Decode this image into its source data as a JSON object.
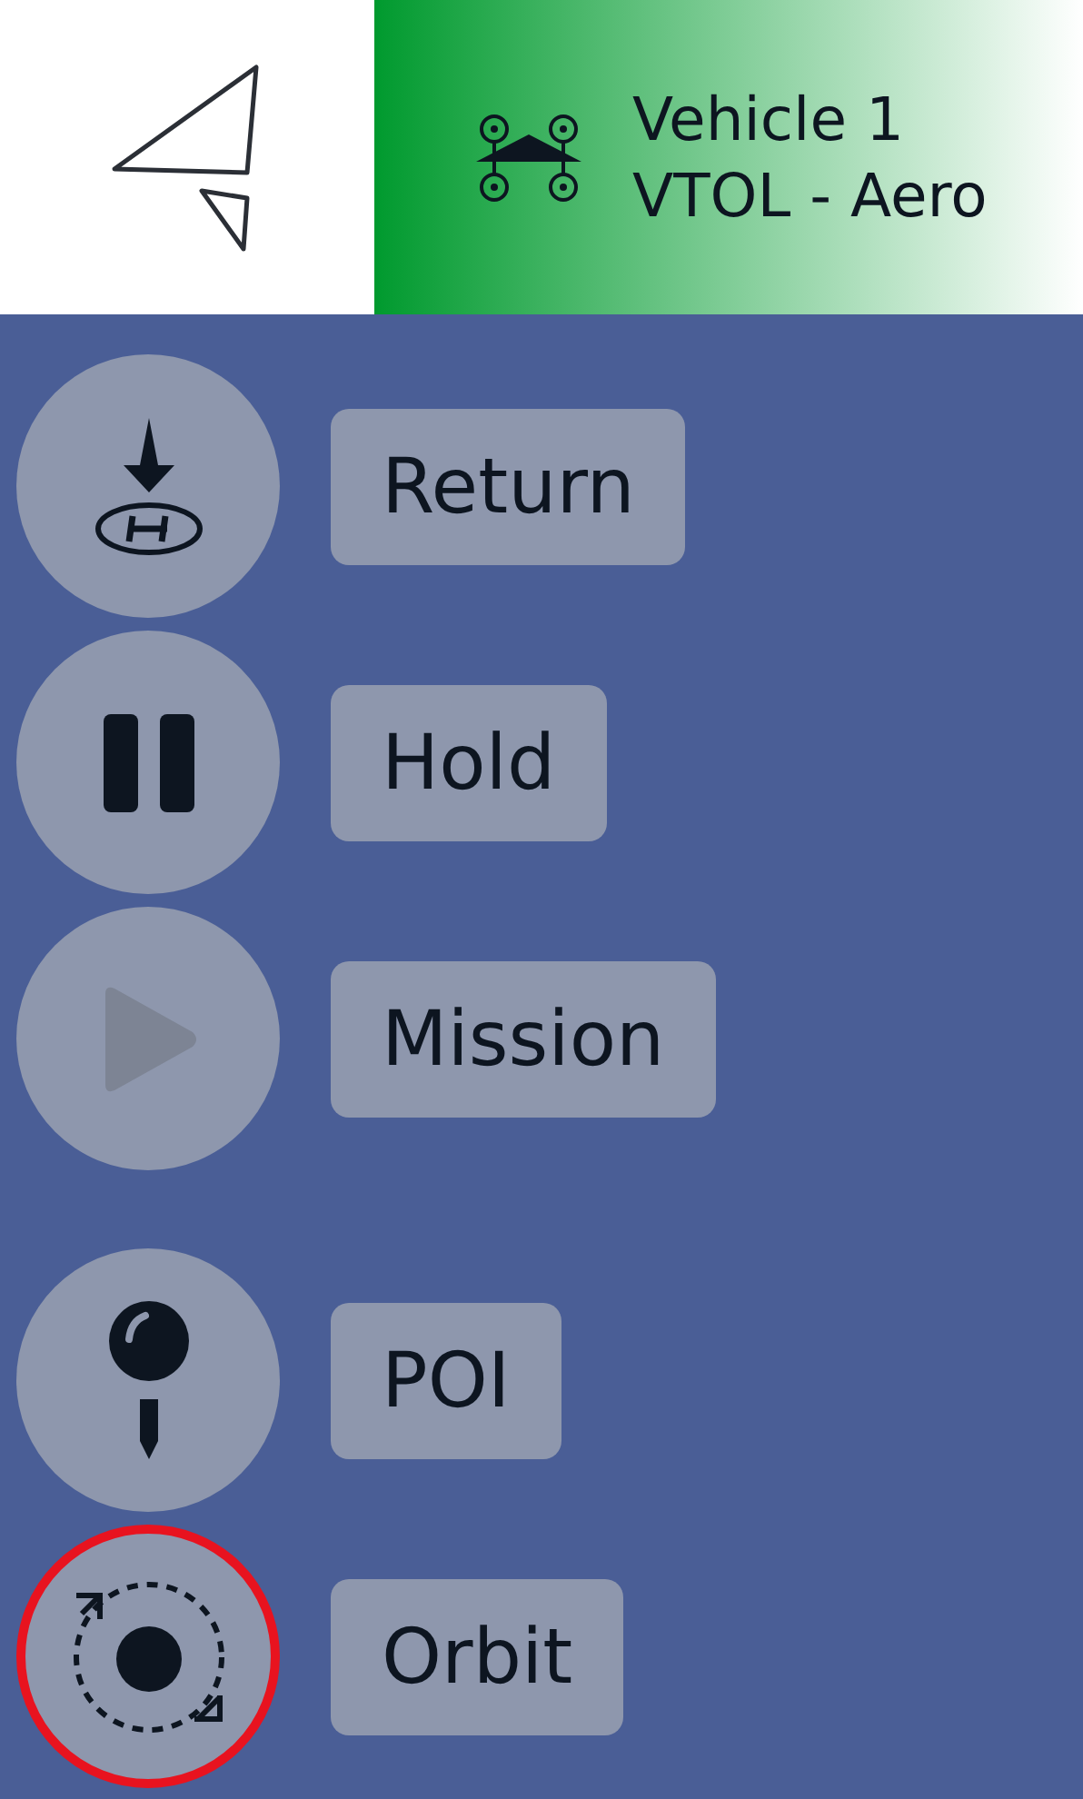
{
  "vehicle": {
    "name": "Vehicle 1",
    "type": "VTOL - Aero"
  },
  "action_groups": [
    [
      {
        "kind": "return",
        "label": "Return",
        "disabled": false,
        "selected": false
      },
      {
        "kind": "hold",
        "label": "Hold",
        "disabled": false,
        "selected": false
      },
      {
        "kind": "mission",
        "label": "Mission",
        "disabled": true,
        "selected": false
      }
    ],
    [
      {
        "kind": "poi",
        "label": "POI",
        "disabled": false,
        "selected": false
      },
      {
        "kind": "orbit",
        "label": "Orbit",
        "disabled": false,
        "selected": true
      }
    ]
  ]
}
